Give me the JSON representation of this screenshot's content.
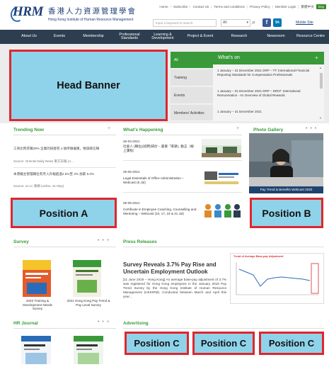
{
  "header": {
    "logo_mark": "HRM",
    "logo_cn": "香港人力資源管理學會",
    "logo_en": "Hong Kong Institute of Human Resource Management",
    "toplinks": [
      "Home",
      "Subscribe",
      "Contact Us",
      "Terms and conditions",
      "Privacy Policy",
      "Member Login",
      "繁體中文"
    ],
    "lang_badge": "Eng",
    "search_placeholder": "Input a keyword to search",
    "search_scope": "All",
    "search_icon": "search-icon",
    "social": [
      "facebook-icon",
      "linkedin-icon"
    ],
    "mobile_link": "Mobile Site"
  },
  "nav": {
    "items": [
      "About Us",
      "Events",
      "Membership",
      "Professional Standards",
      "Learning & Development",
      "Project & Event",
      "Research",
      "Newsroom",
      "Resource Centre"
    ]
  },
  "banner": {
    "label": "Head Banner",
    "tabs": [
      "All",
      "Training",
      "Events",
      "Members' Activities"
    ],
    "whatson_title": "What's on",
    "whatson_items": [
      "1 January – 31 December 2021 DRP – TT: International Financial Reporting Standards for Compensation Professionals",
      "1 January – 31 December 2021 DRP – DR07: International Remuneration - An Overview of Global Rewards",
      "1 January – 31 December 2021"
    ]
  },
  "trending": {
    "title": "Trending Now",
    "items": [
      {
        "text": "工商比例求職28% 企業的技能有 ≥ 後所做偏重，致錄取信賴",
        "source": "Source: Oriental Daily News 東方日報 (A..."
      },
      {
        "text": "本港僱主管理職位有月入升幅超過2.5%至 3% 加薪 5.0%",
        "source": "Source: on.cc 東網 (online, 31 May)"
      }
    ],
    "position_label": "Position A"
  },
  "happening": {
    "title": "What's Happening",
    "items": [
      {
        "date": "26-04-2021",
        "text": "社會人 (職位)(招聘)研討 – 最重「率期」動正（線上課程）"
      },
      {
        "date": "25-05-2021",
        "text": "Legal Essentials of Office Administration – Webcast (6 Jul)"
      },
      {
        "date": "06-05-2021",
        "text": "Certificate in Employee Coaching, Counselling and Mentoring – Webcast (10, 17, 24 & 31 Jul)"
      }
    ]
  },
  "gallery": {
    "title": "Photo Gallery",
    "caption": "Pay Trend & Benefits Webcast 2020",
    "position_label": "Position B"
  },
  "survey": {
    "title": "Survey",
    "books": [
      {
        "label": "2020 Training & Development Needs Survey"
      },
      {
        "label": "2021 Hong Kong Pay Trend & Pay Level Survey"
      }
    ]
  },
  "press": {
    "title": "Press Releases",
    "headline": "Survey Reveals 3.7% Pay Rise and Uncertain Employment Outlook",
    "body": "[11 June 2019 – Hong Kong] An average base-pay adjustment of 3.7% was registered for Hong Kong employees in the January 2019 Pay Trend Survey by the Hong Kong Institute of Human Resource Management (HKIHRM). Conducted between March and April this year...",
    "chart_title": "Trend of Average Base-pay Adjustment"
  },
  "journal": {
    "title": "HR Journal"
  },
  "advertising": {
    "title": "Advertising",
    "positions": [
      "Position C",
      "Position C",
      "Position C"
    ]
  },
  "colors": {
    "nav_bg": "#2c3e50",
    "accent_green": "#3a9a3a",
    "placeholder_blue": "#8fd3ea",
    "placeholder_border": "#e0262c"
  }
}
